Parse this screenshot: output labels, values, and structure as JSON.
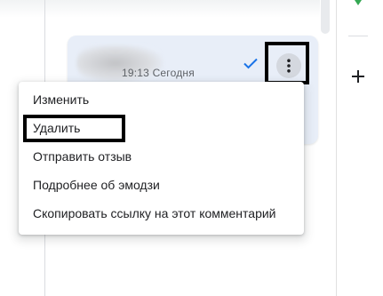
{
  "comment": {
    "timestamp": "19:13 Сегодня"
  },
  "menu": {
    "items": [
      {
        "id": "edit",
        "label": "Изменить"
      },
      {
        "id": "delete",
        "label": "Удалить"
      },
      {
        "id": "send-feedback",
        "label": "Отправить отзыв"
      },
      {
        "id": "emoji-details",
        "label": "Подробнее об эмодзи"
      },
      {
        "id": "copy-link",
        "label": "Скопировать ссылку на этот комментарий"
      }
    ]
  },
  "icons": {
    "check": "check-icon",
    "more": "more-vert-icon",
    "plus": "plus-icon"
  },
  "colors": {
    "card_background": "#e8eef8",
    "check": "#1a73e8",
    "text": "#202124",
    "muted_text": "#5f6368",
    "highlight_border": "#000000",
    "green_mark": "#34a853"
  }
}
